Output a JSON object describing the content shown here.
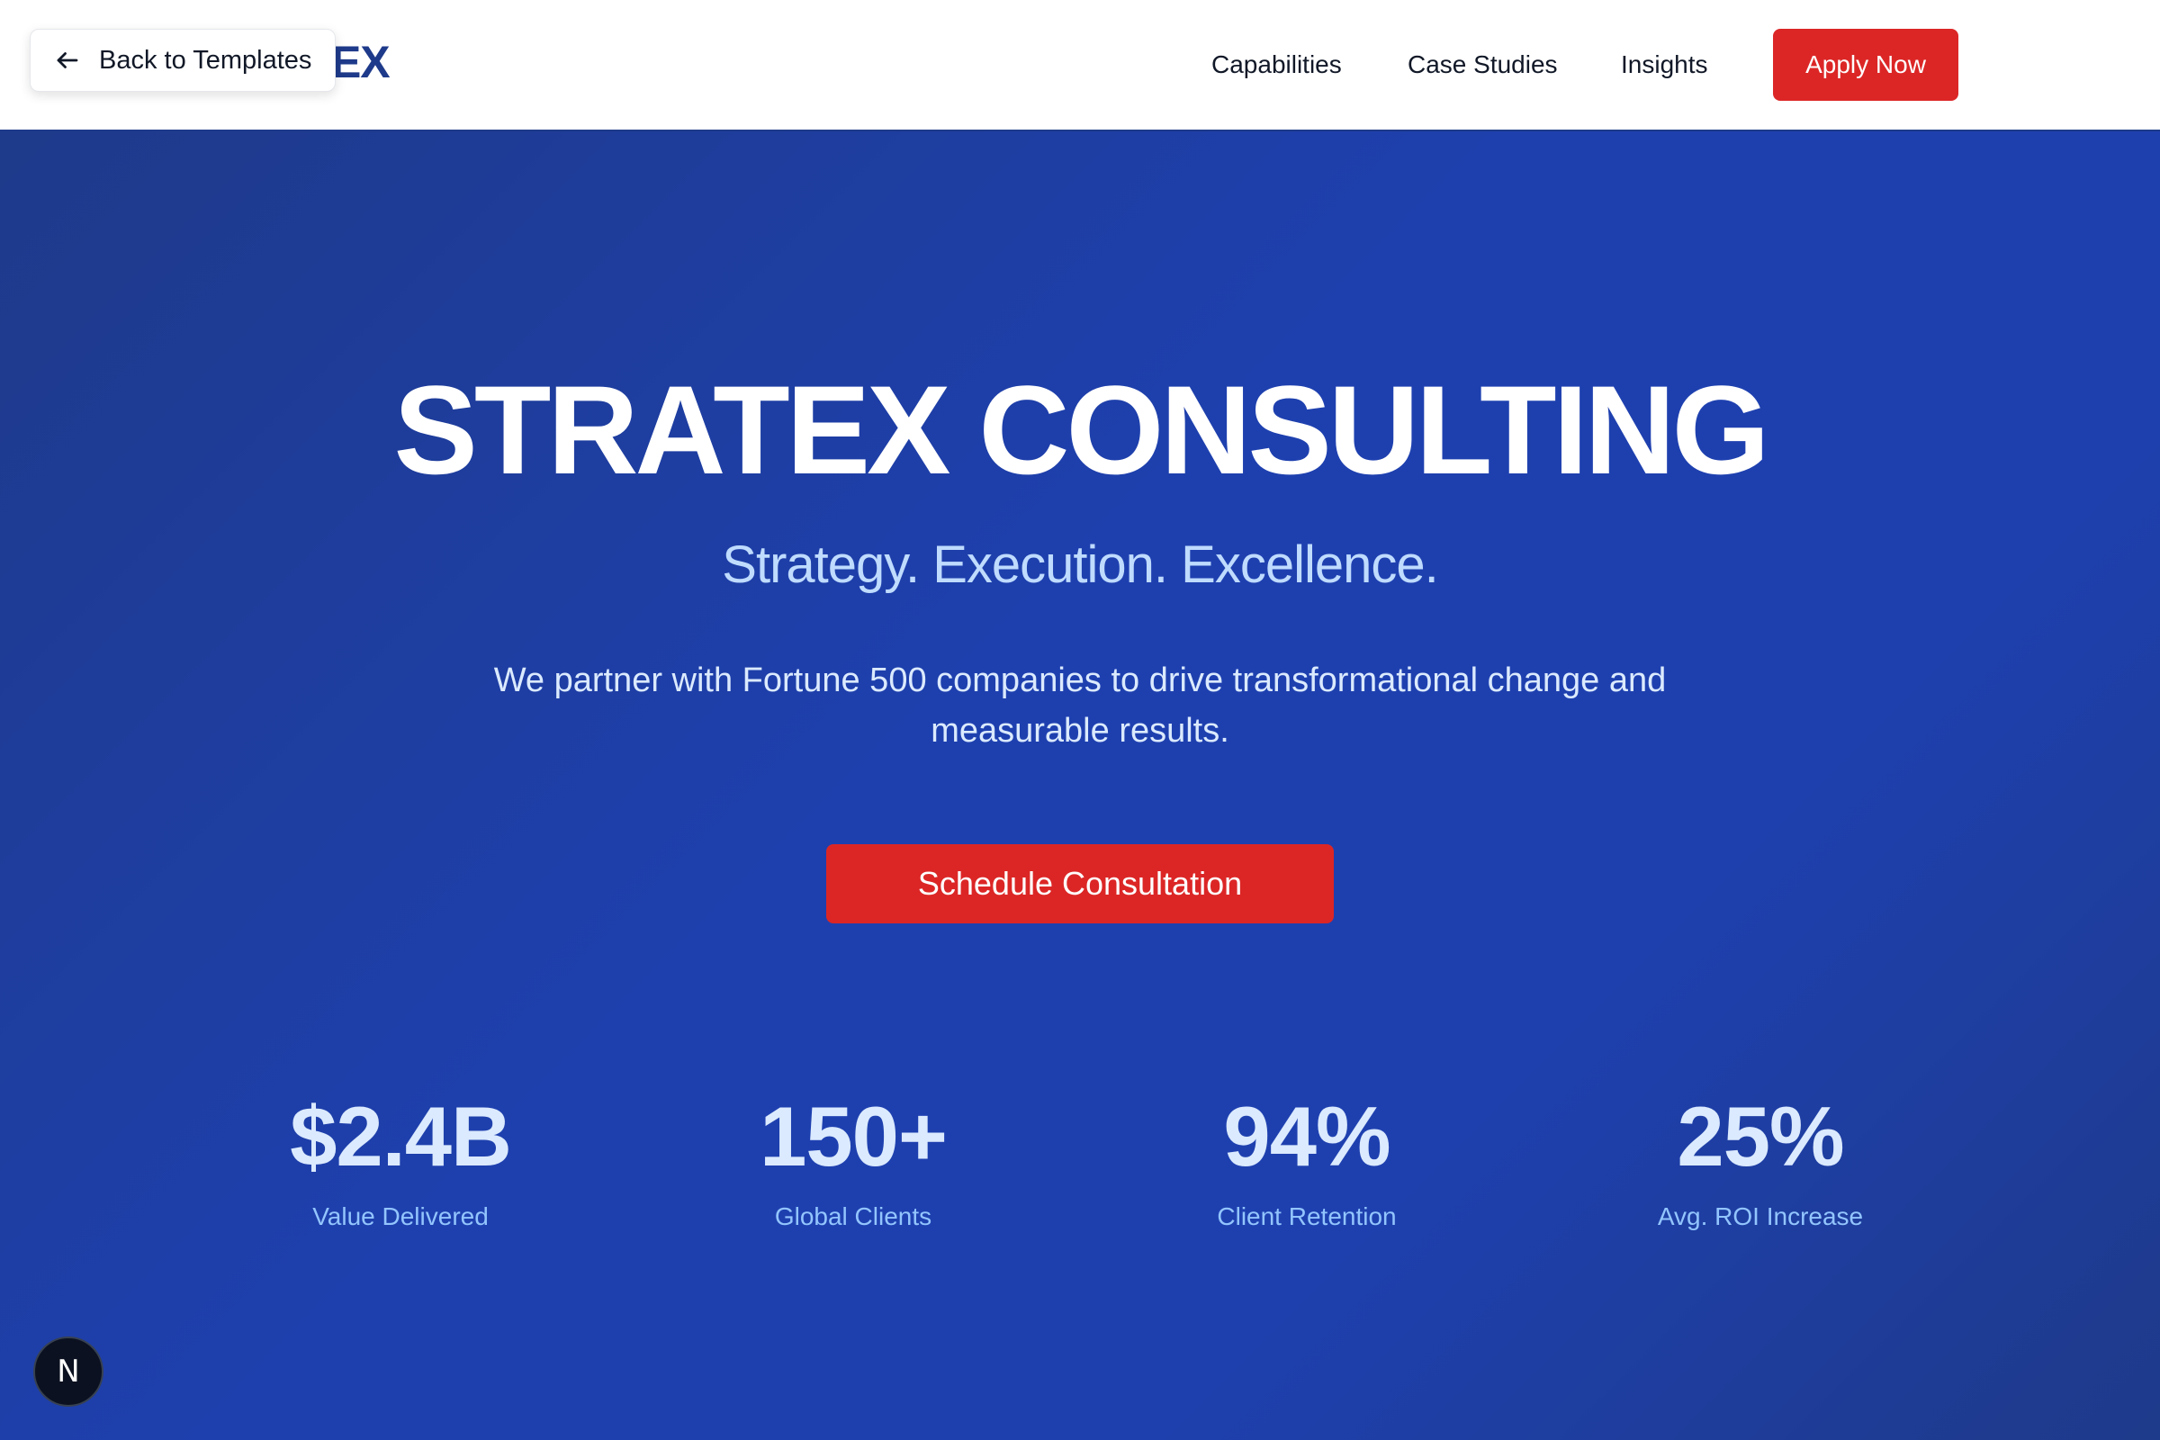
{
  "header": {
    "logo_text": "STRATEX",
    "back_label": "Back to Templates",
    "nav": [
      {
        "label": "Capabilities"
      },
      {
        "label": "Case Studies"
      },
      {
        "label": "Insights"
      }
    ],
    "apply_label": "Apply Now"
  },
  "hero": {
    "title": "STRATEX CONSULTING",
    "tagline": "Strategy. Execution. Excellence.",
    "description": "We partner with Fortune 500 companies to drive transformational change and measurable results.",
    "cta_label": "Schedule Consultation"
  },
  "stats": [
    {
      "value": "$2.4B",
      "label": "Value Delivered"
    },
    {
      "value": "150+",
      "label": "Global Clients"
    },
    {
      "value": "94%",
      "label": "Client Retention"
    },
    {
      "value": "25%",
      "label": "Avg. ROI Increase"
    }
  ],
  "dev_badge": {
    "letter": "N"
  },
  "colors": {
    "brand_blue": "#1e40af",
    "dark_blue": "#1e3a8a",
    "accent_red": "#dc2626",
    "light_blue_text": "#bfdbfe"
  }
}
